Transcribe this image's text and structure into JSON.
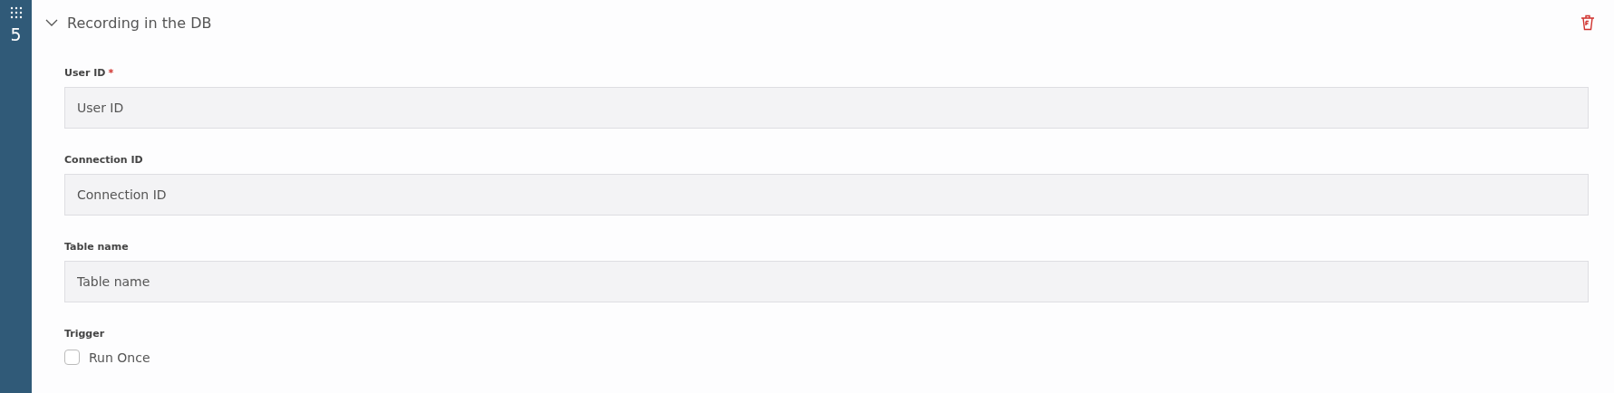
{
  "step": {
    "number": "5"
  },
  "section": {
    "title": "Recording in the DB",
    "expanded": true
  },
  "fields": [
    {
      "label": "User ID",
      "required_mark": "*",
      "placeholder": "User ID"
    },
    {
      "label": "Connection ID",
      "placeholder": "Connection ID"
    },
    {
      "label": "Table name",
      "placeholder": "Table name"
    }
  ],
  "trigger": {
    "label": "Trigger",
    "option": {
      "label": "Run Once",
      "checked": false
    }
  }
}
